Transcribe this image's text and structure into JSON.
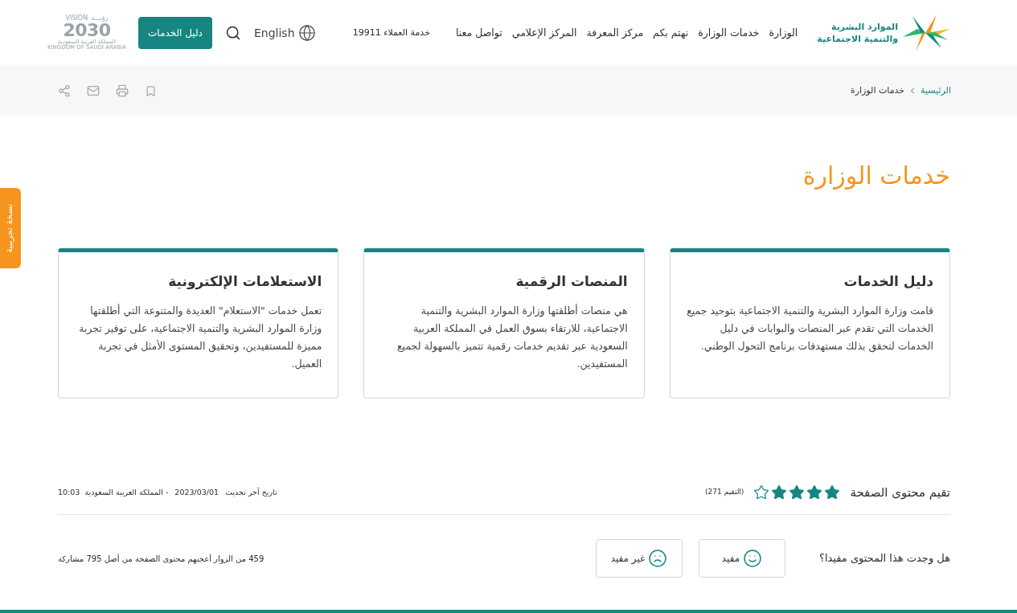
{
  "header": {
    "logo": {
      "line_1": "الموارد البشرية",
      "line_2": "والتنمية الاجتماعية"
    },
    "nav": [
      "الوزارة",
      "خدمات الوزارة",
      "نهتم بكم",
      "مركز المعرفة",
      "المركز الإعلامي",
      "تواصل معنا"
    ],
    "customer_service": "خدمة العملاء 19911",
    "language": "English",
    "services_button": "دليل الخدمات",
    "vision_logo": {
      "arabic": "رؤيـــة",
      "latin": "VISION",
      "year": "2030",
      "line_1": "المملكة العربية السعودية",
      "line_2": "KINGDOM OF SAUDI ARABIA"
    }
  },
  "breadcrumb": [
    "الرئيسية",
    "خدمات الوزارة"
  ],
  "side_tab": "نسخة تجريبية",
  "title": "خدمات الوزارة",
  "cards": [
    {
      "title": "دليل الخدمات",
      "text": "قامت وزارة الموارد البشرية والتنمية الاجتماعية بتوحيد جميع الخدمات التي تقدم عبر المنصات والبوابات في دليل الخدمات لتحقق بذلك مستهدفات برنامج التحول الوطني."
    },
    {
      "title": "المنصات الرقمية",
      "text": "هي منصات أطلقتها وزارة الموارد البشرية والتنمية الاجتماعية، للارتقاء بسوق العمل في المملكة العربية السعودية عبر تقديم خدمات رقمية تتميز بالسهولة لجميع المستفيدين."
    },
    {
      "title": "الاستعلامات الإلكترونية",
      "text": "تعمل خدمات \"الاستعلام\" العديدة والمتنوعة التي أطلقتها وزارة الموارد البشرية والتنمية الاجتماعية، على توفير تجربة مميزة للمستفيدين، وتحقيق المستوى الأمثل في تجربة العميل."
    }
  ],
  "rating": {
    "label": "تقيم محتوى الصفحة",
    "stars": 4,
    "count": "(التقيم 271)"
  },
  "last_update": {
    "label": "تاريخ آخر تحديث",
    "date": "2023/03/01",
    "place_time": "- المملكة العربية السعودية  10:03"
  },
  "feedback": {
    "question": "هل وجدت هذا المحتوى مفيدا؟",
    "buttons": [
      {
        "kind": "positive",
        "label": "مفيد"
      },
      {
        "kind": "negative",
        "label": "غير مفيد"
      }
    ],
    "summary": "459 من الزوار أعجبهم محتوى الصفحة من أصل 795 مشاركة"
  }
}
